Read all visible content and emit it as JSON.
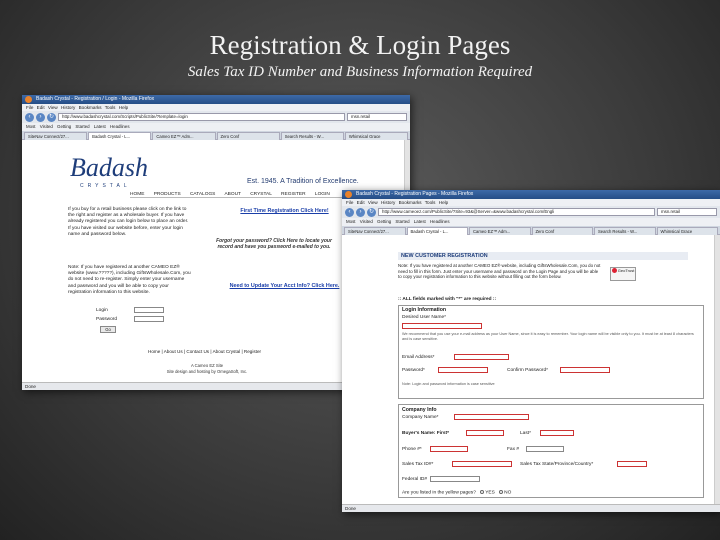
{
  "slide": {
    "title": "Registration & Login Pages",
    "subtitle": "Sales Tax ID Number and Business Information Required"
  },
  "browser1": {
    "window_title": "Badash Crystal - Registration / Login - Mozilla Firefox",
    "menu": "File  Edit  View  History  Bookmarks  Tools  Help",
    "url": "http://www.badashcrystal.com/Scripts/PublicSite/?template=login",
    "search": "msn.retail",
    "bookmarks": "Most Visited   Getting Started   Latest Headlines",
    "tabs": [
      "SiteNav Connect/27...",
      "Badash Crystal - L...",
      "Cameo EZ™ Adm...",
      "Zero Conf",
      "Search Results - W...",
      "Whimsical Grace"
    ],
    "logo": "Badash",
    "logo_sub": "CRYSTAL",
    "tagline": "Est. 1945. A Tradition of Excellence.",
    "nav": "HOME   PRODUCTS   CATALOGS   ABOUT CRYSTAL   REGISTER   LOGIN",
    "left_text": "If you buy for a retail business please click on the link to the right and register as a wholesale buyer. If you have already registered you can login below to place an order. If you have visited our website before, enter your login name and password below.",
    "note_text": "Note: If you have registered at another CAMEO EZ® website (www.?????), including GiftsWholesale.Com, you do not need to re-register. Simply enter your username and password and you will be able to copy your registration information to this website.",
    "first_time": "First Time Registration Click Here!",
    "forgot": "Forgot your password? Click Here to locate your record and have you password e-mailed to you.",
    "update": "Need to Update Your Acct Info? Click Here.",
    "login_label": "Login",
    "password_label": "Password",
    "go_label": "Go",
    "footer_links": "Home | About Us | Contact Us | About Crystal | Register",
    "footer_line1": "A Cameo EZ Site",
    "footer_line2": "Site design and hosting by OmegaSoft, Inc.",
    "status": "Done"
  },
  "browser2": {
    "window_title": "Badash Crystal - Registration Pages - Mozilla Firefox",
    "menu": "File  Edit  View  History  Bookmarks  Tools  Help",
    "url": "http://www.cameoez.com/PublicSite/?Site=93&@Server=&www.badashcrystal.com/Engli",
    "search": "msn.retail",
    "bookmarks": "Most Visited   Getting Started   Latest Headlines",
    "tabs": [
      "SiteNav Connect/27...",
      "Badash Crystal - L...",
      "Cameo EZ™ Adm...",
      "Zero Conf",
      "Search Results - W...",
      "Whimsical Grace"
    ],
    "header": "NEW CUSTOMER REGISTRATION",
    "note": "Note: If you have registered at another CAMEO EZ® website, including GiftsWholesale.Com, you do not need to fill in this form. Just enter your username and password on the Login Page and you will be able to copy your registration information to this website without filling out the form below.",
    "badge_text": "GeoTrust",
    "required": ":: ALL fields marked with \"*\" are required ::",
    "login_section": "Login Information",
    "desired_user": "Desired User Name*",
    "login_note": "We recommend that you use your e-mail address as your User Name, since it is easy to remember. Your login name will be visible only to you. It must be at least 8 characters and is case sensitive.",
    "email": "Email Address*",
    "password": "Password*",
    "confirm": "Confirm Password*",
    "password_note": "Note: Login and password information is case sensitive",
    "company_section": "Company Info",
    "company_name": "Company Name*",
    "buyer_first": "Buyer's Name: First*",
    "buyer_last": "Last*",
    "phone": "Phone #*",
    "fax": "Fax #",
    "sales_tax": "Sales Tax ID#*",
    "sales_tax_state": "Sales Tax State/Province/Country*",
    "federal": "Federal ID#",
    "yellow_pages": "Are you listed in the yellow pages?",
    "yes": "YES",
    "no": "NO",
    "status": "Done"
  }
}
